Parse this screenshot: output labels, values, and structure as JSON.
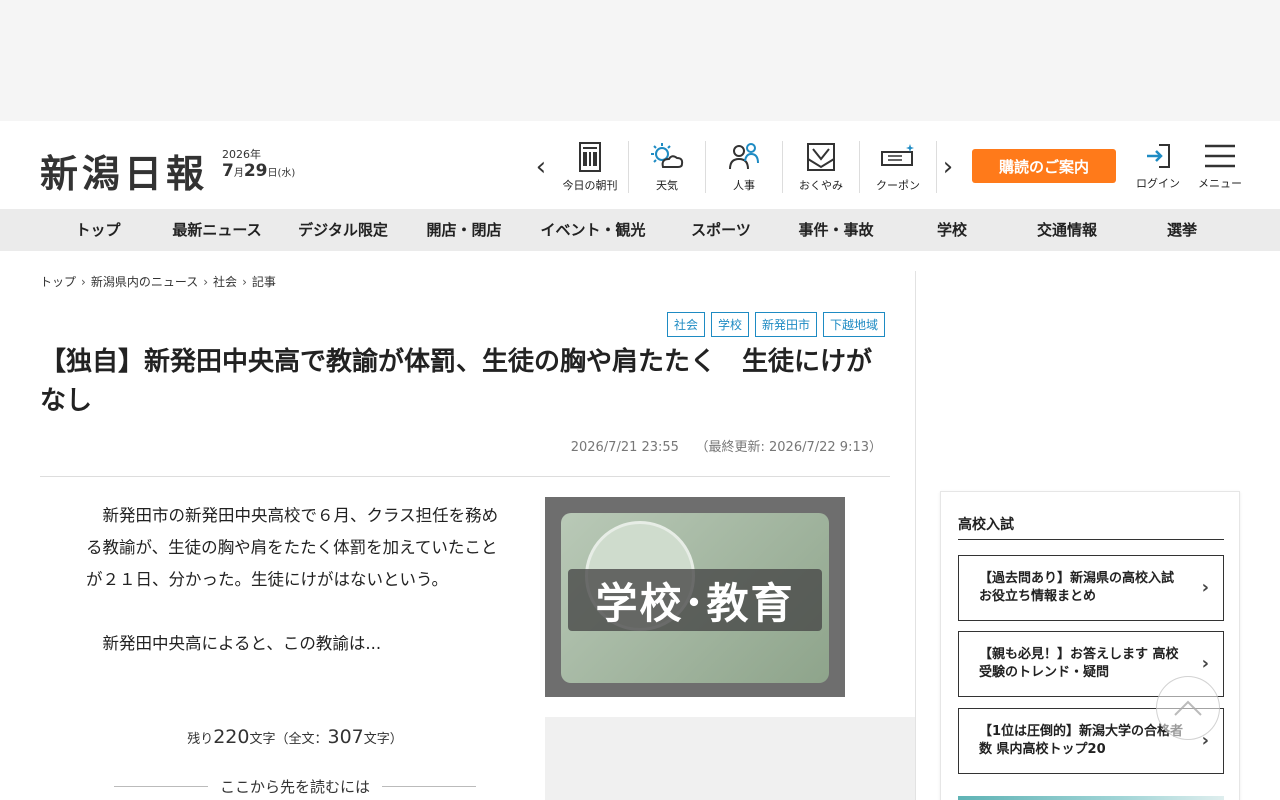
{
  "header": {
    "logo": "新潟日報",
    "date": {
      "year": "2026年",
      "month": "7",
      "month_unit": "月",
      "day": "29",
      "day_unit": "日",
      "weekday": "(水)"
    },
    "quick_links": [
      {
        "label": "今日の朝刊",
        "icon": "newspaper-icon"
      },
      {
        "label": "天気",
        "icon": "weather-icon"
      },
      {
        "label": "人事",
        "icon": "people-icon"
      },
      {
        "label": "おくやみ",
        "icon": "condolence-icon"
      },
      {
        "label": "クーポン",
        "icon": "coupon-icon"
      }
    ],
    "subscribe": "購読のご案内",
    "login": "ログイン",
    "menu": "メニュー"
  },
  "nav": [
    "トップ",
    "最新ニュース",
    "デジタル限定",
    "開店・閉店",
    "イベント・観光",
    "スポーツ",
    "事件・事故",
    "学校",
    "交通情報",
    "選挙"
  ],
  "breadcrumb": [
    "トップ",
    "新潟県内のニュース",
    "社会",
    "記事"
  ],
  "article": {
    "tags": [
      "社会",
      "学校",
      "新発田市",
      "下越地域"
    ],
    "title": "【独自】新発田中央高で教諭が体罰、生徒の胸や肩たたく　生徒にけがなし",
    "published": "2026/7/21 23:55",
    "updated": "（最終更新: 2026/7/22 9:13）",
    "paragraphs": [
      "新発田市の新発田中央高校で６月、クラス担任を務める教諭が、生徒の胸や肩をたたく体罰を加えていたことが２１日、分かった。生徒にけがはないという。",
      "新発田中央高によると、この教諭は..."
    ],
    "remaining": {
      "prefix": "残り",
      "remain": "220",
      "mid": "文字（全文：",
      "total": "307",
      "suffix": "文字）"
    },
    "read_more": "ここから先を読むには",
    "photo_caption": "学校･教育"
  },
  "sidebar": {
    "heading": "高校入試",
    "links": [
      "【過去問あり】新潟県の高校入試 お役立ち情報まとめ",
      "【親も必見！】お答えします 高校受験のトレンド・疑問",
      "【1位は圧倒的】新潟大学の合格者数 県内高校トップ20"
    ]
  }
}
